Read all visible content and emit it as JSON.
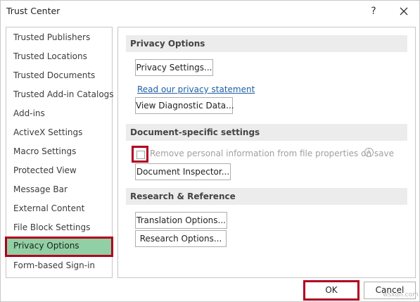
{
  "window": {
    "title": "Trust Center",
    "help_glyph": "?",
    "close_label": "Close"
  },
  "sidebar": {
    "items": [
      {
        "label": "Trusted Publishers"
      },
      {
        "label": "Trusted Locations"
      },
      {
        "label": "Trusted Documents"
      },
      {
        "label": "Trusted Add-in Catalogs"
      },
      {
        "label": "Add-ins"
      },
      {
        "label": "ActiveX Settings"
      },
      {
        "label": "Macro Settings"
      },
      {
        "label": "Protected View"
      },
      {
        "label": "Message Bar"
      },
      {
        "label": "External Content"
      },
      {
        "label": "File Block Settings"
      },
      {
        "label": "Privacy Options",
        "selected": true
      },
      {
        "label": "Form-based Sign-in"
      }
    ],
    "selected_color": "#91d0a4"
  },
  "privacy": {
    "header": "Privacy Options",
    "settings_button": "Privacy Settings...",
    "privacy_link": "Read our privacy statement",
    "diagnostic_button": "View Diagnostic Data..."
  },
  "document_specific": {
    "header": "Document-specific settings",
    "remove_info_label": "Remove personal information from file properties on save",
    "remove_info_checked": false,
    "remove_info_enabled": false,
    "inspector_button": "Document Inspector..."
  },
  "research": {
    "header": "Research & Reference",
    "translation_button": "Translation Options...",
    "research_button": "Research Options..."
  },
  "footer": {
    "ok_label": "OK",
    "cancel_label": "Cancel"
  },
  "watermark": "wsxdn.com",
  "colors": {
    "highlight_border": "#b00020",
    "link": "#1f5fa8",
    "section_bg": "#ececec"
  }
}
